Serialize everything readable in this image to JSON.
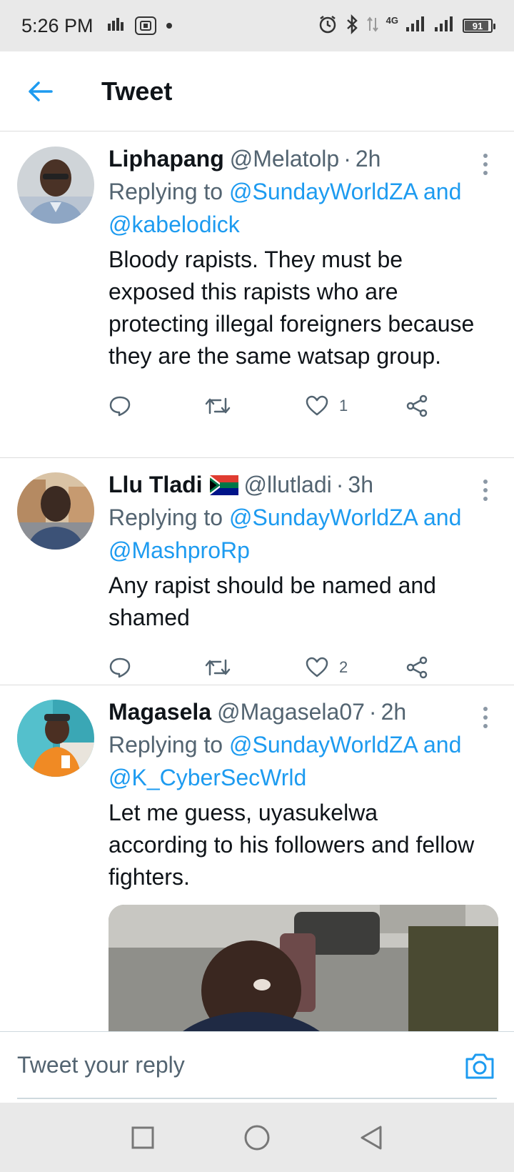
{
  "status_bar": {
    "time": "5:26 PM",
    "network_label": "4G",
    "battery_level": "91",
    "battery_fraction": 0.91,
    "left_icons": [
      "sim-icon",
      "screen-record-icon",
      "dot-icon"
    ],
    "right_icons": [
      "alarm-icon",
      "bluetooth-icon",
      "data-arrows-icon",
      "signal-icon",
      "signal-icon",
      "battery-icon"
    ]
  },
  "header": {
    "title": "Tweet",
    "back_icon": "arrow-left-icon"
  },
  "colors": {
    "accent": "#1d9bf0",
    "secondary_text": "#536471",
    "primary_text": "#0f1419",
    "system_bar": "#e9e9e9"
  },
  "tweets": [
    {
      "name": "Liphapang",
      "handle": "@Melatolp",
      "separator": "·",
      "time": "2h",
      "replying_prefix": "Replying to",
      "mention_1": "@SundayWorldZA",
      "and_label": "and",
      "mention_2": "@kabelodick",
      "text": "Bloody rapists. They must be exposed this rapists who are protecting illegal foreigners because they are the same watsap group.",
      "likes": "1"
    },
    {
      "name": "Llu Tladi",
      "flag": "south-africa-flag",
      "handle": "@llutladi",
      "separator": "·",
      "time": "3h",
      "replying_prefix": "Replying to",
      "mention_1": "@SundayWorldZA",
      "and_label": "and",
      "mention_2": "@MashproRp",
      "text": "Any rapist should be named and shamed",
      "likes": "2"
    },
    {
      "name": "Magasela",
      "handle": "@Magasela07",
      "separator": "·",
      "time": "2h",
      "replying_prefix": "Replying to",
      "mention_1": "@SundayWorldZA",
      "and_label": "and",
      "mention_2": "@K_CyberSecWrld",
      "text": "Let me guess, uyasukelwa according to his followers and fellow fighters."
    }
  ],
  "reply_bar": {
    "placeholder": "Tweet your reply",
    "camera_icon": "camera-icon"
  },
  "nav_bar": {
    "buttons": [
      "recents-square-icon",
      "home-circle-icon",
      "back-triangle-icon"
    ]
  }
}
